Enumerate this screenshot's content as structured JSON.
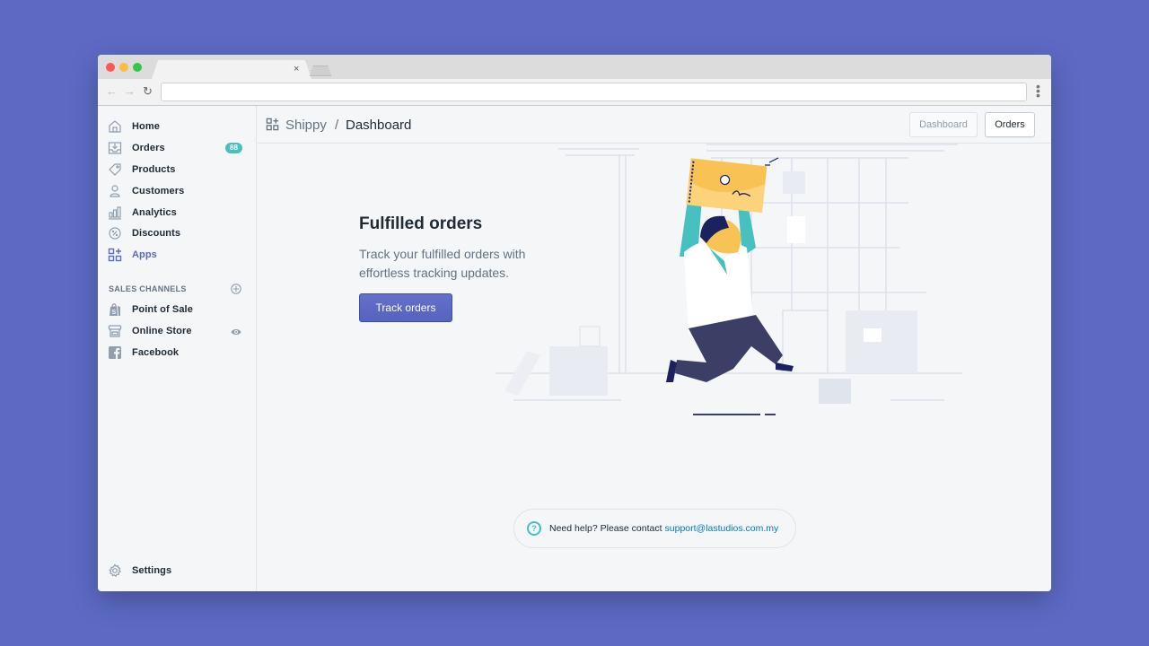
{
  "browser": {
    "tab_close": "×",
    "back": "←",
    "forward": "→",
    "reload": "↻",
    "menu": "⋮",
    "address_value": ""
  },
  "sidebar": {
    "items": [
      {
        "label": "Home",
        "icon": "home-icon"
      },
      {
        "label": "Orders",
        "icon": "orders-icon",
        "badge": "88"
      },
      {
        "label": "Products",
        "icon": "tag-icon"
      },
      {
        "label": "Customers",
        "icon": "person-icon"
      },
      {
        "label": "Analytics",
        "icon": "bar-chart-icon"
      },
      {
        "label": "Discounts",
        "icon": "discount-icon"
      },
      {
        "label": "Apps",
        "icon": "apps-icon",
        "active": true
      }
    ],
    "section_title": "SALES CHANNELS",
    "channels": [
      {
        "label": "Point of Sale",
        "icon": "shopping-bag-icon"
      },
      {
        "label": "Online Store",
        "icon": "storefront-icon"
      },
      {
        "label": "Facebook",
        "icon": "facebook-icon"
      }
    ],
    "settings": {
      "label": "Settings",
      "icon": "gear-icon"
    }
  },
  "topbar": {
    "app_name": "Shippy",
    "separator": "/",
    "page": "Dashboard",
    "buttons": {
      "dashboard": "Dashboard",
      "orders": "Orders"
    }
  },
  "empty_state": {
    "title": "Fulfilled orders",
    "description": "Track your fulfilled orders with effortless tracking updates.",
    "action": "Track orders"
  },
  "help": {
    "text": "Need help? Please contact",
    "email": "support@lastudios.com.my",
    "icon": "?"
  },
  "colors": {
    "background": "#5c6ac4",
    "accent": "#5c6ac4",
    "badge": "#47c1bf",
    "link": "#007ace"
  }
}
